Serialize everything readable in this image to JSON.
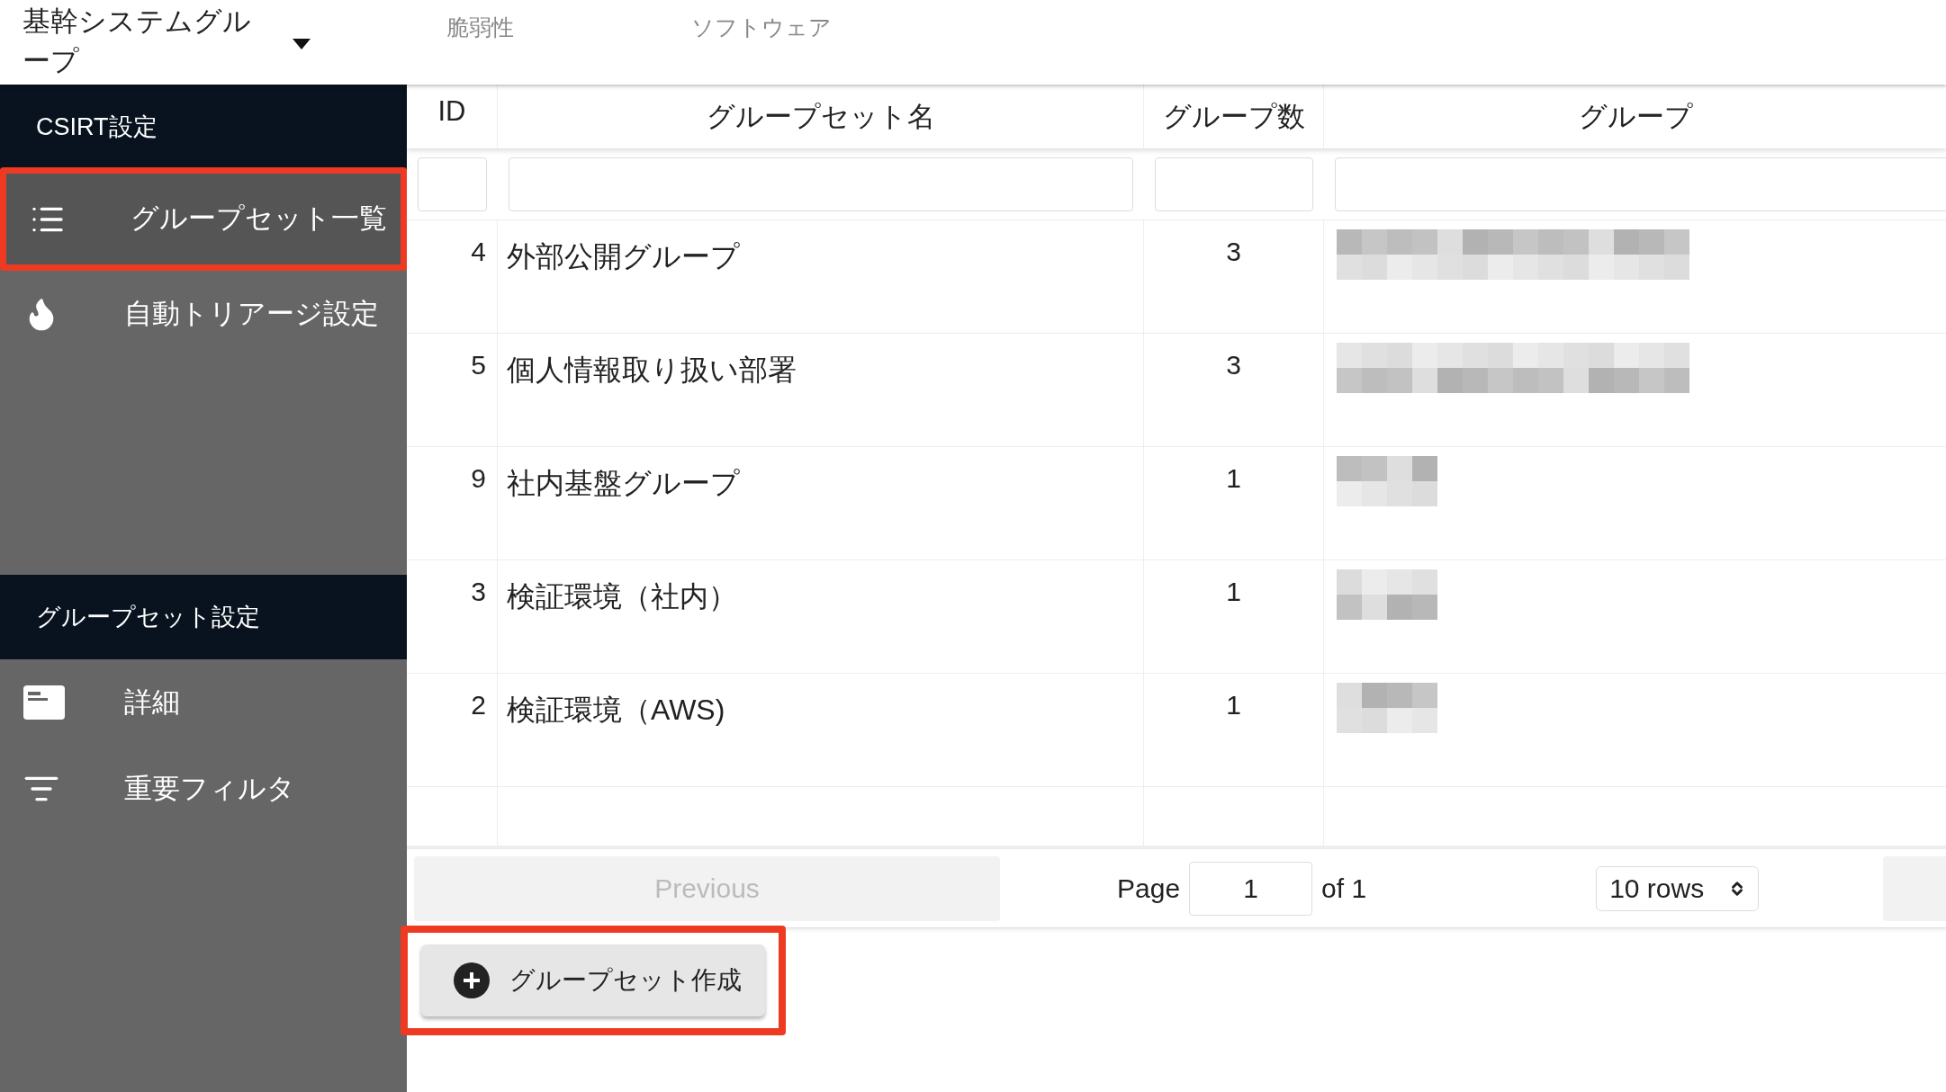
{
  "header": {
    "group_selector": {
      "label": "基幹システムグループ"
    },
    "tabs": [
      {
        "label": "脆弱性",
        "selected": false
      },
      {
        "label": "ソフトウェア",
        "selected": false
      }
    ]
  },
  "sidebar": {
    "sections": [
      {
        "title": "CSIRT設定",
        "items": [
          {
            "label": "グループセット一覧",
            "kind": "list",
            "selected": true,
            "highlighted": true
          },
          {
            "label": "自動トリアージ設定",
            "kind": "flame",
            "selected": false,
            "highlighted": false
          }
        ]
      },
      {
        "title": "グループセット設定",
        "items": [
          {
            "label": "詳細",
            "kind": "card",
            "selected": false,
            "highlighted": false
          },
          {
            "label": "重要フィルタ",
            "kind": "filter",
            "selected": false,
            "highlighted": false
          }
        ]
      }
    ]
  },
  "table": {
    "columns": [
      "ID",
      "グループセット名",
      "グループ数",
      "グループ"
    ],
    "rows": [
      {
        "id": "4",
        "name": "外部公開グループ",
        "count": "3",
        "kind": "long"
      },
      {
        "id": "5",
        "name": "個人情報取り扱い部署",
        "count": "3",
        "kind": "long"
      },
      {
        "id": "9",
        "name": "社内基盤グループ",
        "count": "1",
        "kind": "short"
      },
      {
        "id": "3",
        "name": "検証環境（社内）",
        "count": "1",
        "kind": "short"
      },
      {
        "id": "2",
        "name": "検証環境（AWS)",
        "count": "1",
        "kind": "short"
      }
    ]
  },
  "pagination": {
    "previous": "Previous",
    "page_label": "Page",
    "page": "1",
    "of": "of 1",
    "rows": "10 rows"
  },
  "create_button": {
    "label": "グループセット作成",
    "highlighted": true
  }
}
